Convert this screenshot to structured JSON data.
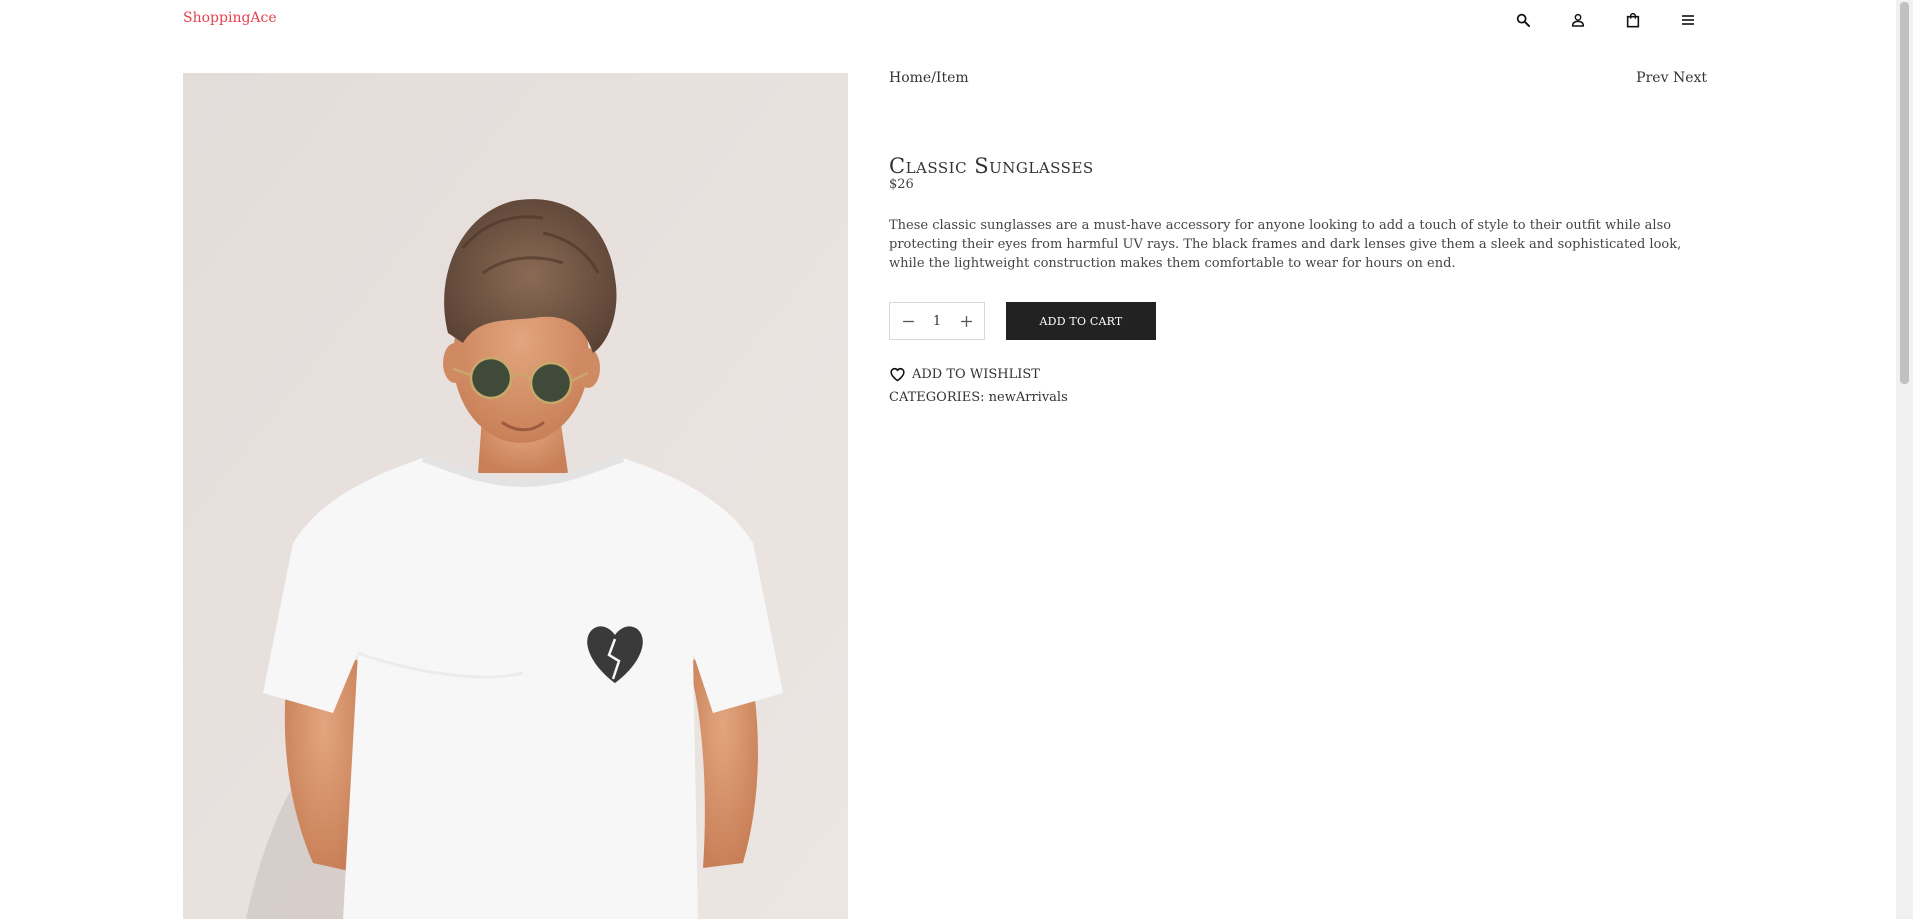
{
  "header": {
    "brand": "ShoppingAce",
    "icons": [
      "search-icon",
      "user-icon",
      "bag-icon",
      "menu-icon"
    ]
  },
  "product": {
    "image_alt": "Young man in white t-shirt wearing round sunglasses",
    "breadcrumb": "Home/Item",
    "prev_label": "Prev",
    "next_label": "Next",
    "title": "Classic Sunglasses",
    "price": "$26",
    "description": "These classic sunglasses are a must-have accessory for anyone looking to add a touch of style to their outfit while also protecting their eyes from harmful UV rays. The black frames and dark lenses give them a sleek and sophisticated look, while the lightweight construction makes them comfortable to wear for hours on end.",
    "quantity": "1",
    "add_to_cart_label": "ADD TO CART",
    "wishlist_label": "ADD TO WISHLIST",
    "categories_label": "CATEGORIES:",
    "category": "newArrivals"
  },
  "colors": {
    "brand": "#e8414d",
    "button_bg": "#222222",
    "text": "#333333"
  }
}
